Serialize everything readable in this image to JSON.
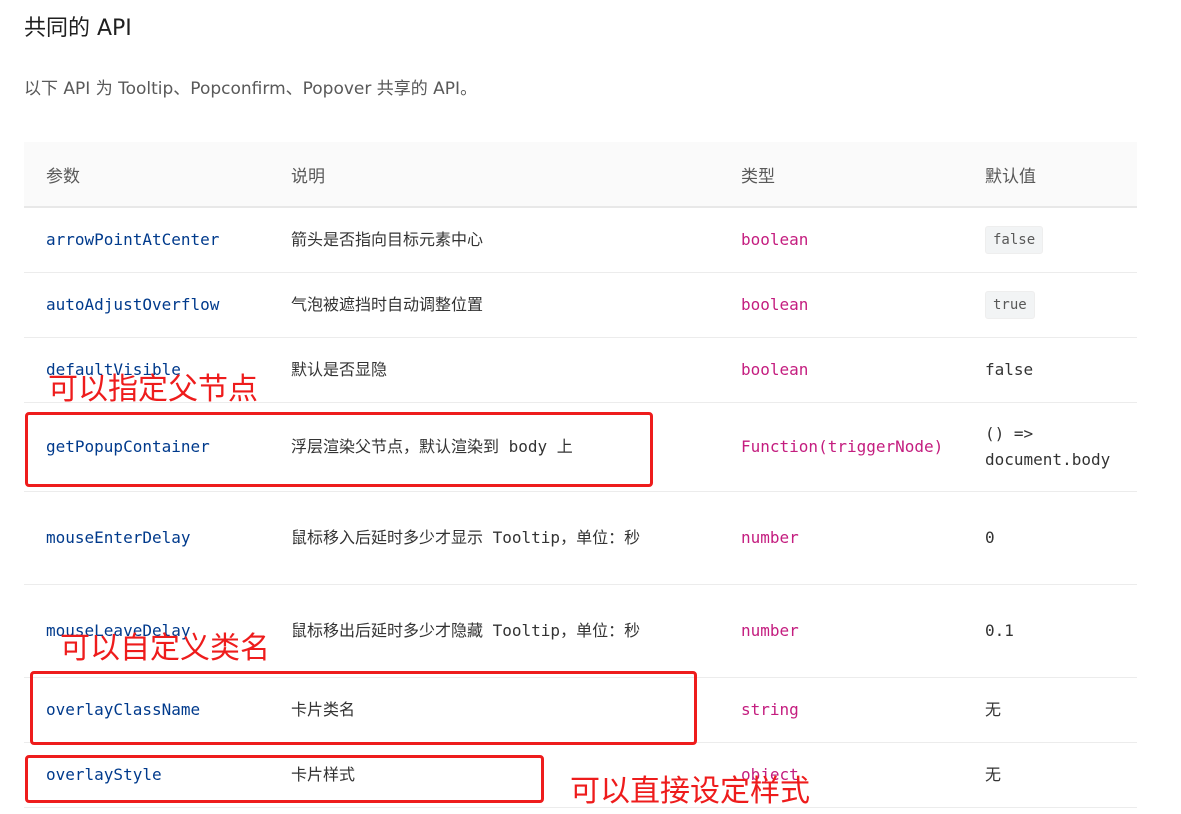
{
  "section": {
    "title": "共同的 API",
    "intro": "以下 API 为 Tooltip、Popconfirm、Popover 共享的 API。"
  },
  "table": {
    "headers": [
      "参数",
      "说明",
      "类型",
      "默认值"
    ],
    "rows": [
      {
        "name": "arrowPointAtCenter",
        "desc": "箭头是否指向目标元素中心",
        "type": "boolean",
        "default": "false"
      },
      {
        "name": "autoAdjustOverflow",
        "desc": "气泡被遮挡时自动调整位置",
        "type": "boolean",
        "default": "true"
      },
      {
        "name": "defaultVisible",
        "desc": "默认是否显隐",
        "type": "boolean",
        "default": "false"
      },
      {
        "name": "getPopupContainer",
        "desc": "浮层渲染父节点，默认渲染到 body 上",
        "type": "Function(triggerNode)",
        "default": "() => document.body"
      },
      {
        "name": "mouseEnterDelay",
        "desc": "鼠标移入后延时多少才显示 Tooltip，单位：秒",
        "type": "number",
        "default": "0"
      },
      {
        "name": "mouseLeaveDelay",
        "desc": "鼠标移出后延时多少才隐藏 Tooltip，单位：秒",
        "type": "number",
        "default": "0.1"
      },
      {
        "name": "overlayClassName",
        "desc": "卡片类名",
        "type": "string",
        "default": "无"
      },
      {
        "name": "overlayStyle",
        "desc": "卡片样式",
        "type": "object",
        "default": "无"
      }
    ]
  },
  "annotations": {
    "parent_node": "可以指定父节点",
    "class_name": "可以自定义类名",
    "style": "可以直接设定样式",
    "color": "#ee1c1c"
  }
}
